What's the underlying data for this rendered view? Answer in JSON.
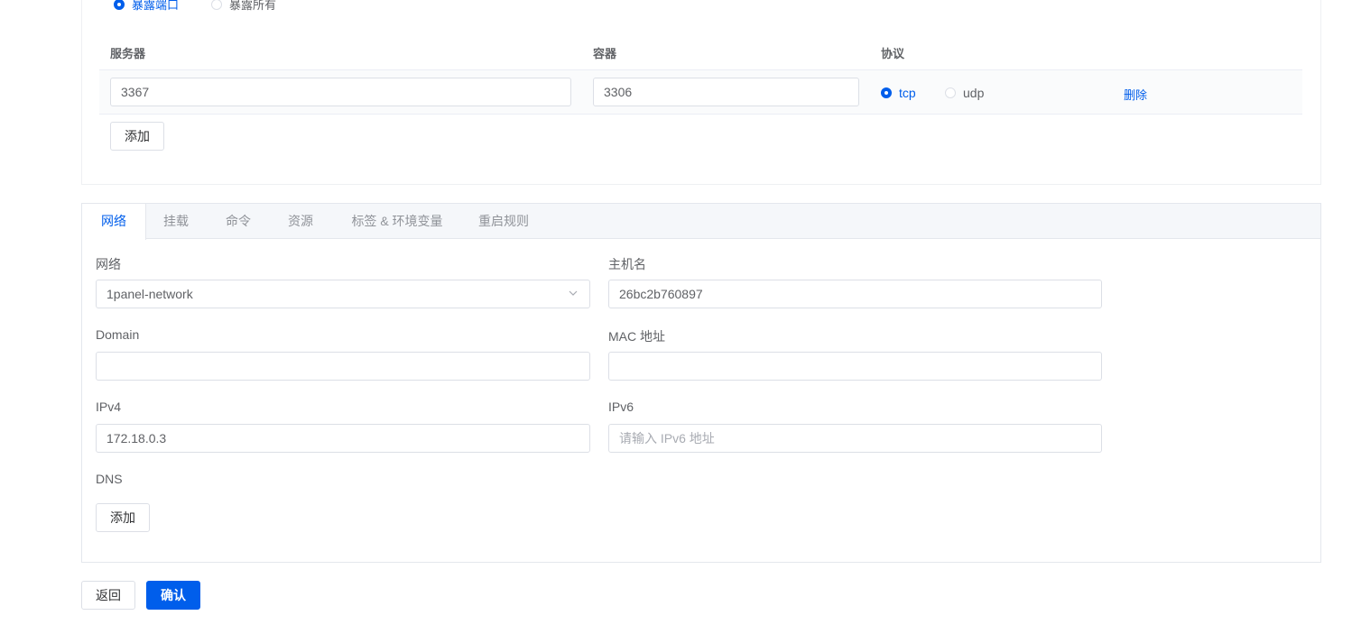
{
  "ports": {
    "mode_options": [
      "暴露端口",
      "暴露所有"
    ],
    "columns": [
      "服务器",
      "容器",
      "协议"
    ],
    "row": {
      "server": "3367",
      "container": "3306",
      "protocols": [
        "tcp",
        "udp"
      ],
      "delete_label": "删除"
    },
    "add_label": "添加"
  },
  "tabs": [
    "网络",
    "挂载",
    "命令",
    "资源",
    "标签 & 环境变量",
    "重启规则"
  ],
  "network": {
    "network_label": "网络",
    "network_value": "1panel-network",
    "hostname_label": "主机名",
    "hostname_value": "26bc2b760897",
    "domain_label": "Domain",
    "domain_value": "",
    "mac_label": "MAC 地址",
    "mac_value": "",
    "ipv4_label": "IPv4",
    "ipv4_value": "172.18.0.3",
    "ipv6_label": "IPv6",
    "ipv6_placeholder": "请输入 IPv6 地址",
    "dns_label": "DNS",
    "dns_add_label": "添加"
  },
  "footer": {
    "back_label": "返回",
    "confirm_label": "确认"
  },
  "colors": {
    "primary": "#005eeb",
    "border": "#dcdfe6"
  }
}
